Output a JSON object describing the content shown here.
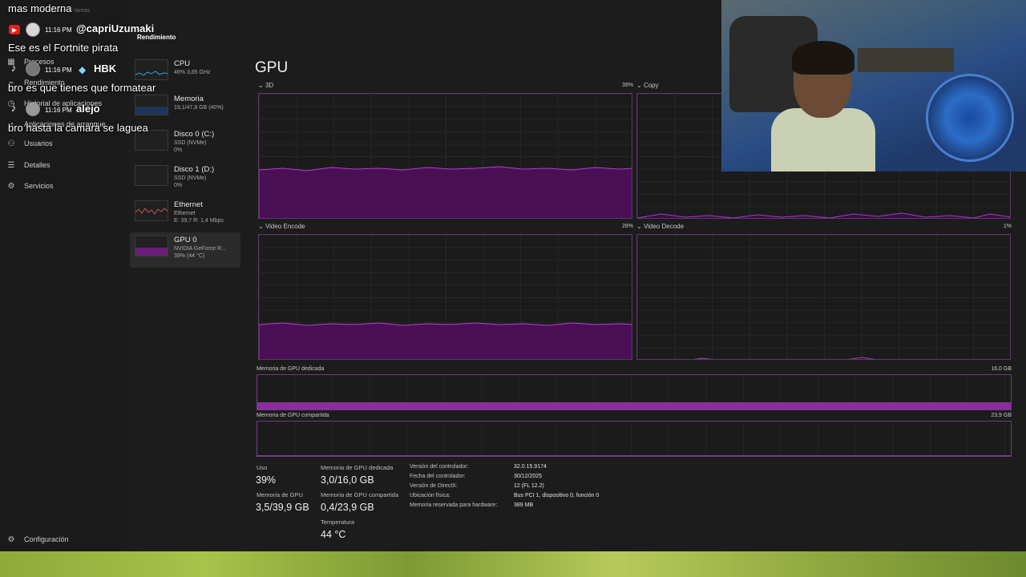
{
  "app": {
    "window_title": "Administrador de tareas",
    "nav": {
      "items": [
        {
          "label": "Procesos",
          "icon": "grid-icon"
        },
        {
          "label": "Rendimiento",
          "icon": "activity-icon"
        },
        {
          "label": "Historial de aplicaciones",
          "icon": "history-icon"
        },
        {
          "label": "Aplicaciones de arranque",
          "icon": "speedometer-icon"
        },
        {
          "label": "Usuarios",
          "icon": "users-icon"
        },
        {
          "label": "Detalles",
          "icon": "list-icon"
        },
        {
          "label": "Servicios",
          "icon": "puzzle-icon"
        }
      ],
      "settings_label": "Configuración",
      "page_heading": "Rendimiento"
    },
    "devices": [
      {
        "name": "CPU",
        "sub1": "46% 3,85 GHz",
        "sub2": ""
      },
      {
        "name": "Memoria",
        "sub1": "19,1/47,8 GB (40%)",
        "sub2": ""
      },
      {
        "name": "Disco 0 (C:)",
        "sub1": "SSD (NVMe)",
        "sub2": "0%"
      },
      {
        "name": "Disco 1 (D:)",
        "sub1": "SSD (NVMe)",
        "sub2": "0%"
      },
      {
        "name": "Ethernet",
        "sub1": "Ethernet",
        "sub2": "E: 39,7 R: 1,4 Mbps"
      },
      {
        "name": "GPU 0",
        "sub1": "NVIDIA GeForce R...",
        "sub2": "39% (44 °C)"
      }
    ],
    "gpu": {
      "title": "GPU",
      "graphs": [
        {
          "label": "3D",
          "pct": "39%"
        },
        {
          "label": "Copy",
          "pct": ""
        },
        {
          "label": "Video Encode",
          "pct": "28%"
        },
        {
          "label": "Video Decode",
          "pct": "1%"
        }
      ],
      "dedicated_label": "Memoria de GPU dedicada",
      "dedicated_max": "16,0 GB",
      "shared_label": "Memoria de GPU compartida",
      "shared_max": "23,9 GB",
      "stats": {
        "uso_label": "Uso",
        "uso_value": "39%",
        "gpu_mem_label": "Memoria de GPU",
        "gpu_mem_value": "3,5/39,9 GB",
        "ded_label": "Memoria de GPU dedicada",
        "ded_value": "3,0/16,0 GB",
        "shared_label": "Memoria de GPU compartida",
        "shared_value": "0,4/23,9 GB",
        "temp_label": "Temperatura",
        "temp_value": "44 °C"
      },
      "info": [
        {
          "k": "Versión del controlador:",
          "v": "32.0.15.9174"
        },
        {
          "k": "Fecha del controlador:",
          "v": "30/12/2025"
        },
        {
          "k": "Versión de DirectX:",
          "v": "12 (FL 12.2)"
        },
        {
          "k": "Ubicación física:",
          "v": "Bus PCI 1, dispositivo 0, función 0"
        },
        {
          "k": "Memoria reservada para hardware:",
          "v": "389 MB"
        }
      ],
      "dedicated_fill_fraction": 0.19,
      "shared_fill_fraction": 0.02
    }
  },
  "chat": {
    "lines": [
      {
        "text": "mas moderna"
      },
      {
        "time": "11:16 PM",
        "user": "@capriUzumaki",
        "platform": "youtube"
      },
      {
        "text": "Ese es el Fortnite pirata"
      },
      {
        "time": "11:16 PM",
        "user": "HBK",
        "platform": "tiktok"
      },
      {
        "text": "bro es que tienes que formatear"
      },
      {
        "time": "11:16 PM",
        "user": "alejo",
        "platform": "tiktok"
      },
      {
        "text": "bro hasta la camara se laguea"
      }
    ]
  }
}
